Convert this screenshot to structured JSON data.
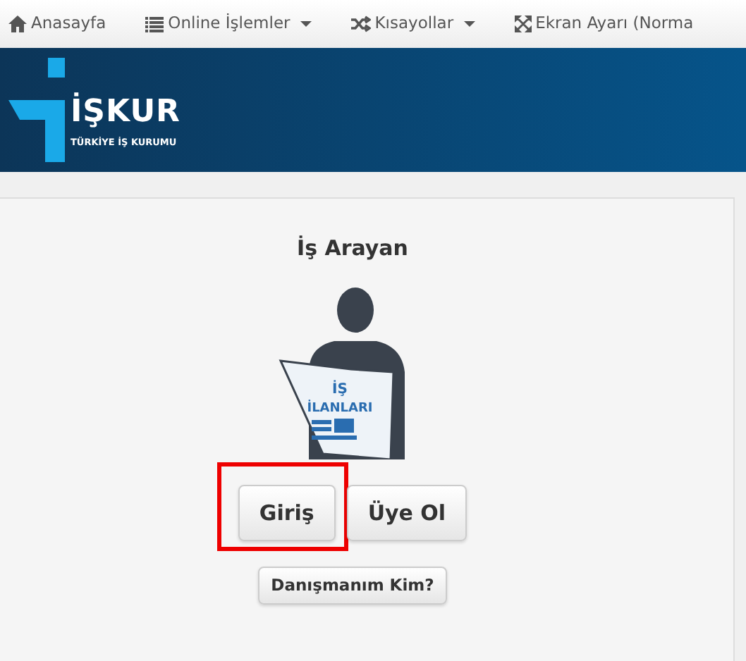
{
  "nav": [
    {
      "kind": "home",
      "label": "Anasayfa",
      "dropdown": false
    },
    {
      "kind": "list",
      "label": "Online İşlemler",
      "dropdown": true
    },
    {
      "kind": "shuffle",
      "label": "Kısayollar",
      "dropdown": true
    },
    {
      "kind": "expand",
      "label": "Ekran Ayarı (Norma",
      "dropdown": false
    }
  ],
  "banner": {
    "logo_name": "İŞKUR",
    "logo_subtitle": "TÜRKİYE İŞ KURUMU"
  },
  "panel": {
    "title": "İş Arayan",
    "newspaper_lines": [
      "İŞ",
      "İLANLARI"
    ],
    "buttons": [
      {
        "label": "Giriş",
        "highlighted": true
      },
      {
        "label": "Üye Ol",
        "highlighted": false
      }
    ],
    "secondary_button": "Danışmanım Kim?"
  }
}
